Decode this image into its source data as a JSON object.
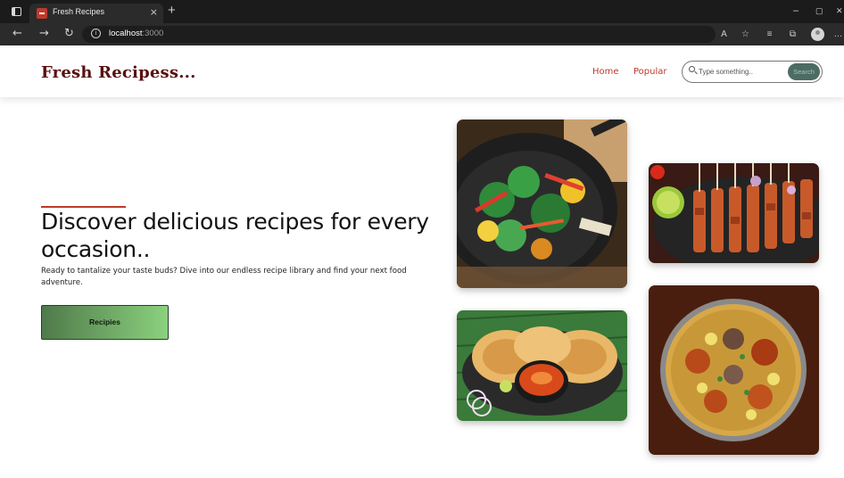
{
  "browser": {
    "tab_title": "Fresh Recipes",
    "tab_close": "×",
    "new_tab": "+",
    "url_host": "localhost",
    "url_port": ":3000",
    "minimize": "–",
    "restore": "▢",
    "close": "✕"
  },
  "header": {
    "logo": "Fresh Recipess...",
    "nav": [
      "Home",
      "Popular"
    ],
    "search": {
      "placeholder": "Type something..",
      "button_label": "Search"
    }
  },
  "hero": {
    "title": "Discover delicious recipes for every occasion..",
    "subtitle": "Ready to tantalize your taste buds? Dive into our endless recipe library and find your next food adventure.",
    "cta_label": "Recipies"
  },
  "images": [
    {
      "subject": "vegetable stir fry in wok"
    },
    {
      "subject": "grilled chicken skewers"
    },
    {
      "subject": "paratha with curry"
    },
    {
      "subject": "chicken biryani"
    }
  ],
  "colors": {
    "brand": "#5a0f0f",
    "accent": "#c0392b",
    "cta_start": "#4f7a4a",
    "cta_end": "#8bd17e",
    "search_button": "#4d6b62"
  }
}
